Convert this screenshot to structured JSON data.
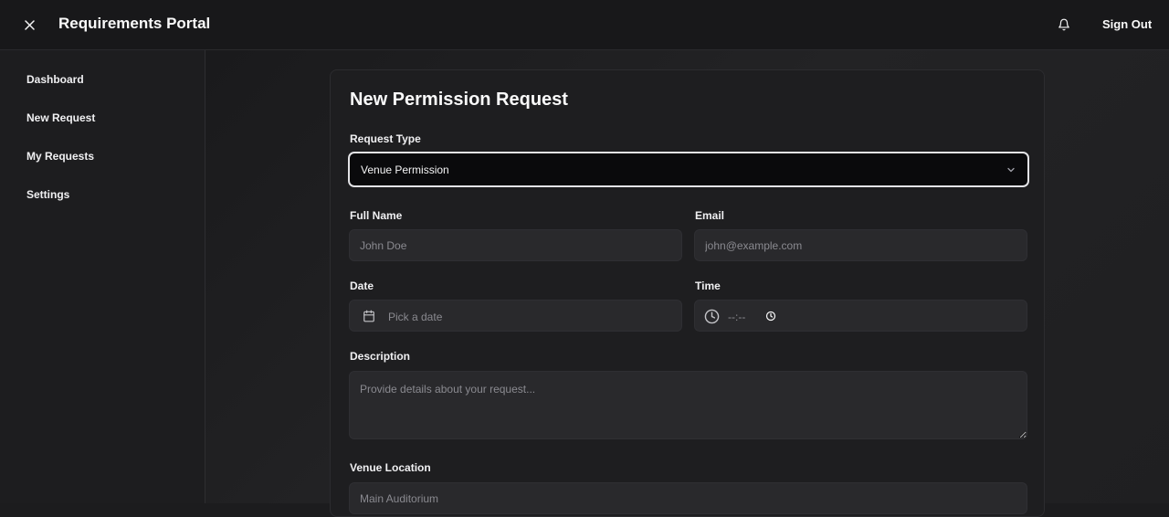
{
  "header": {
    "title": "Requirements Portal",
    "close_icon": "close-icon",
    "bell_icon": "bell-icon",
    "sign_out": "Sign Out"
  },
  "sidebar": {
    "items": [
      {
        "label": "Dashboard"
      },
      {
        "label": "New Request"
      },
      {
        "label": "My Requests"
      },
      {
        "label": "Settings"
      }
    ]
  },
  "form": {
    "title": "New Permission Request",
    "request_type": {
      "label": "Request Type",
      "value": "Venue Permission"
    },
    "full_name": {
      "label": "Full Name",
      "placeholder": "John Doe"
    },
    "email": {
      "label": "Email",
      "placeholder": "john@example.com"
    },
    "date": {
      "label": "Date",
      "placeholder": "Pick a date"
    },
    "time": {
      "label": "Time",
      "placeholder": "--:--"
    },
    "description": {
      "label": "Description",
      "placeholder": "Provide details about your request..."
    },
    "venue_location": {
      "label": "Venue Location",
      "placeholder": "Main Auditorium"
    }
  },
  "colors": {
    "background": "#1c1c1e",
    "card": "#1e1e20",
    "input": "#29292c",
    "select_border": "#e4e4e7",
    "text": "#f4f4f5",
    "placeholder": "#8a8a90"
  }
}
